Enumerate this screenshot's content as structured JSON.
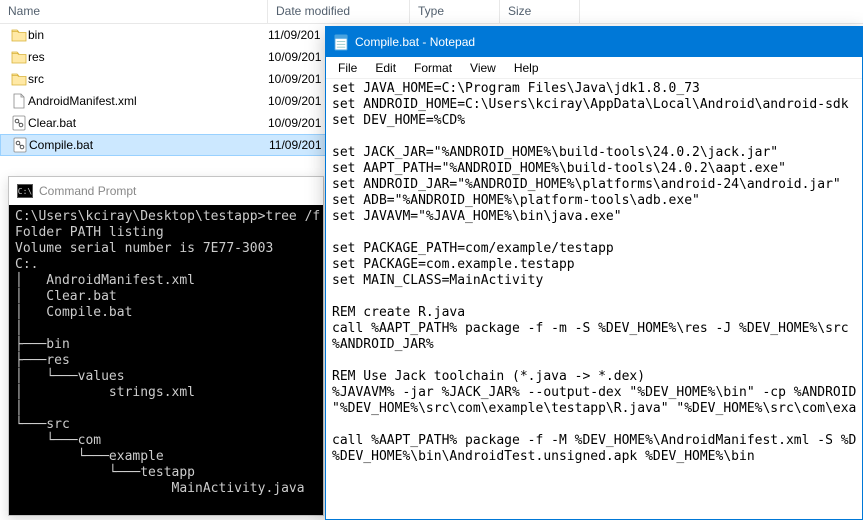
{
  "explorer": {
    "columns": {
      "name": "Name",
      "date": "Date modified",
      "type": "Type",
      "size": "Size"
    },
    "rows": [
      {
        "icon": "folder",
        "name": "bin",
        "date": "11/09/201",
        "selected": false
      },
      {
        "icon": "folder",
        "name": "res",
        "date": "10/09/201",
        "selected": false
      },
      {
        "icon": "folder",
        "name": "src",
        "date": "10/09/201",
        "selected": false
      },
      {
        "icon": "file",
        "name": "AndroidManifest.xml",
        "date": "10/09/201",
        "selected": false
      },
      {
        "icon": "bat",
        "name": "Clear.bat",
        "date": "10/09/201",
        "selected": false
      },
      {
        "icon": "bat",
        "name": "Compile.bat",
        "date": "11/09/201",
        "selected": true
      }
    ]
  },
  "cmd": {
    "title": "Command Prompt",
    "prompt_glyph": "C:\\",
    "body": "C:\\Users\\kciray\\Desktop\\testapp>tree /f\nFolder PATH listing\nVolume serial number is 7E77-3003\nC:.\n│   AndroidManifest.xml\n│   Clear.bat\n│   Compile.bat\n│\n├───bin\n├───res\n│   └───values\n│           strings.xml\n│\n└───src\n    └───com\n        └───example\n            └───testapp\n                    MainActivity.java\n"
  },
  "notepad": {
    "title": "Compile.bat - Notepad",
    "menu": {
      "file": "File",
      "edit": "Edit",
      "format": "Format",
      "view": "View",
      "help": "Help"
    },
    "body": "set JAVA_HOME=C:\\Program Files\\Java\\jdk1.8.0_73\nset ANDROID_HOME=C:\\Users\\kciray\\AppData\\Local\\Android\\android-sdk\nset DEV_HOME=%CD%\n\nset JACK_JAR=\"%ANDROID_HOME%\\build-tools\\24.0.2\\jack.jar\"\nset AAPT_PATH=\"%ANDROID_HOME%\\build-tools\\24.0.2\\aapt.exe\"\nset ANDROID_JAR=\"%ANDROID_HOME%\\platforms\\android-24\\android.jar\"\nset ADB=\"%ANDROID_HOME%\\platform-tools\\adb.exe\"\nset JAVAVM=\"%JAVA_HOME%\\bin\\java.exe\"\n\nset PACKAGE_PATH=com/example/testapp\nset PACKAGE=com.example.testapp\nset MAIN_CLASS=MainActivity\n\nREM create R.java\ncall %AAPT_PATH% package -f -m -S %DEV_HOME%\\res -J %DEV_HOME%\\src \n%ANDROID_JAR%\n\nREM Use Jack toolchain (*.java -> *.dex)\n%JAVAVM% -jar %JACK_JAR% --output-dex \"%DEV_HOME%\\bin\" -cp %ANDROID\n\"%DEV_HOME%\\src\\com\\example\\testapp\\R.java\" \"%DEV_HOME%\\src\\com\\exa\n\ncall %AAPT_PATH% package -f -M %DEV_HOME%\\AndroidManifest.xml -S %D\n%DEV_HOME%\\bin\\AndroidTest.unsigned.apk %DEV_HOME%\\bin"
  }
}
